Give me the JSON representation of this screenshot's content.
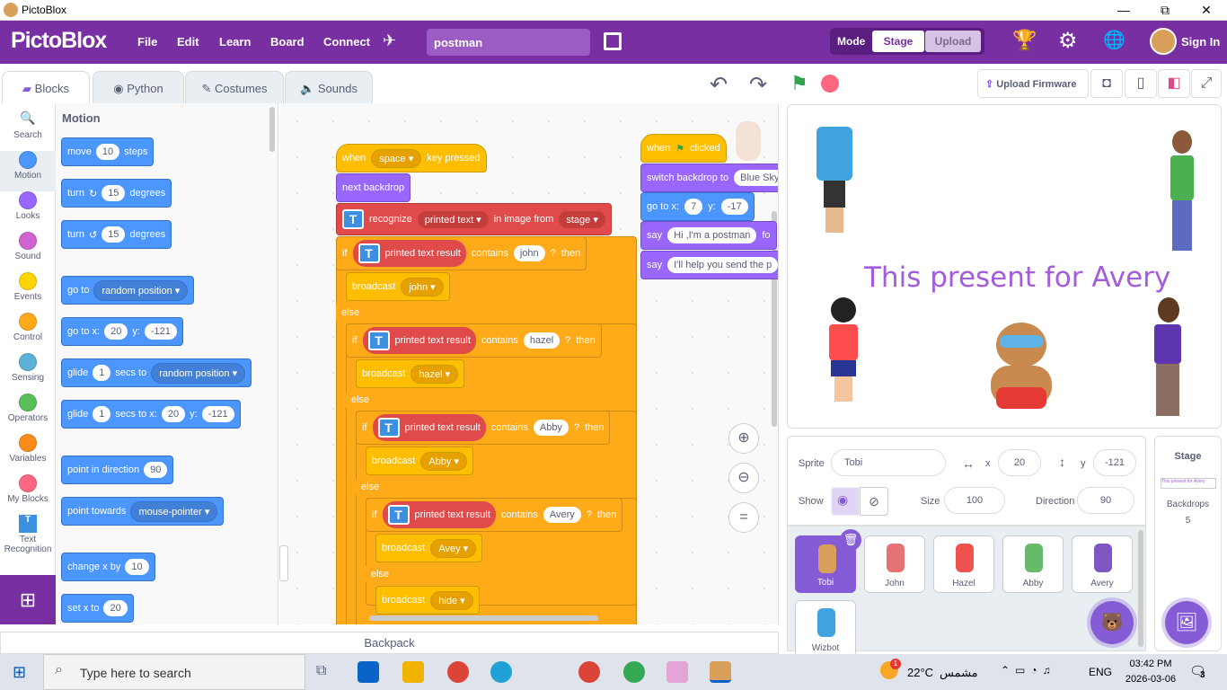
{
  "window": {
    "title": "PictoBlox",
    "minimize": "—",
    "maximize": "⧉",
    "close": "✕"
  },
  "menubar": {
    "logo": "PictoBlox",
    "items": [
      "File",
      "Edit",
      "Learn",
      "Board",
      "Connect"
    ],
    "project_name": "postman",
    "mode_label": "Mode",
    "stage_label": "Stage",
    "upload_label": "Upload",
    "signin": "Sign In"
  },
  "tabs": {
    "blocks": "Blocks",
    "python": "Python",
    "costumes": "Costumes",
    "sounds": "Sounds"
  },
  "toolbar": {
    "upload_firmware": "Upload Firmware"
  },
  "categories": [
    {
      "label": "Search",
      "color": ""
    },
    {
      "label": "Motion",
      "color": "#4c97ff"
    },
    {
      "label": "Looks",
      "color": "#9966ff"
    },
    {
      "label": "Sound",
      "color": "#cf63cf"
    },
    {
      "label": "Events",
      "color": "#ffd500"
    },
    {
      "label": "Control",
      "color": "#ffab19"
    },
    {
      "label": "Sensing",
      "color": "#5cb1d6"
    },
    {
      "label": "Operators",
      "color": "#59c059"
    },
    {
      "label": "Variables",
      "color": "#ff8c1a"
    },
    {
      "label": "My Blocks",
      "color": "#ff6680"
    },
    {
      "label": "Text Recognition",
      "color": ""
    }
  ],
  "palette": {
    "heading": "Motion",
    "move": {
      "a": "move",
      "v": "10",
      "b": "steps"
    },
    "turn_cw": {
      "a": "turn",
      "v": "15",
      "b": "degrees"
    },
    "turn_ccw": {
      "a": "turn",
      "v": "15",
      "b": "degrees"
    },
    "goto": {
      "a": "go to",
      "dd": "random position"
    },
    "gotoxy": {
      "a": "go to x:",
      "x": "20",
      "b": "y:",
      "y": "-121"
    },
    "glide": {
      "a": "glide",
      "v": "1",
      "b": "secs to",
      "dd": "random position"
    },
    "glidexy": {
      "a": "glide",
      "v": "1",
      "b": "secs to x:",
      "x": "20",
      "c": "y:",
      "y": "-121"
    },
    "point": {
      "a": "point in direction",
      "v": "90"
    },
    "towards": {
      "a": "point towards",
      "dd": "mouse-pointer"
    },
    "changex": {
      "a": "change x by",
      "v": "10"
    },
    "setx": {
      "a": "set x to",
      "v": "20"
    }
  },
  "script1": {
    "when": "when",
    "key": "space",
    "pressed": "key pressed",
    "next": "next backdrop",
    "recognize": "recognize",
    "printed": "printed text",
    "inimage": "in image from",
    "stage": "stage",
    "if": "if",
    "then": "then",
    "else": "else",
    "result": "printed text result",
    "contains": "contains",
    "broadcast": "broadcast",
    "q": "?",
    "names": [
      "john",
      "hazel",
      "Abby",
      "Avery"
    ],
    "bc": [
      "john",
      "hazel",
      "Abby",
      "Avey",
      "hide"
    ]
  },
  "script2": {
    "when": "when",
    "clicked": "clicked",
    "switch": "switch backdrop to",
    "backdrop": "Blue Sky",
    "goto": "go to x:",
    "x": "7",
    "y_lbl": "y:",
    "y": "-17",
    "say": "say",
    "say1": "Hi ,I'm a postman",
    "fo": "fo",
    "say2": "I'll help you send the p"
  },
  "backpack": "Backpack",
  "stage": {
    "text": "This present for Avery"
  },
  "sprite": {
    "label": "Sprite",
    "name": "Tobi",
    "x_lbl": "x",
    "x": "20",
    "y_lbl": "y",
    "y": "-121",
    "show": "Show",
    "size_lbl": "Size",
    "size": "100",
    "dir_lbl": "Direction",
    "dir": "90"
  },
  "sprites": [
    "Tobi",
    "John",
    "Hazel",
    "Abby",
    "Avery",
    "Wizbot"
  ],
  "stagepanel": {
    "title": "Stage",
    "thumb_text": "This present for Avery",
    "backdrops_lbl": "Backdrops",
    "backdrops": "5"
  },
  "taskbar": {
    "search": "Type here to search",
    "weather": "22°C",
    "weather_word": "مشمس",
    "lang": "ENG",
    "time": "03:42 PM",
    "date": "2026-03-06",
    "notif": "3",
    "badge": "1"
  }
}
